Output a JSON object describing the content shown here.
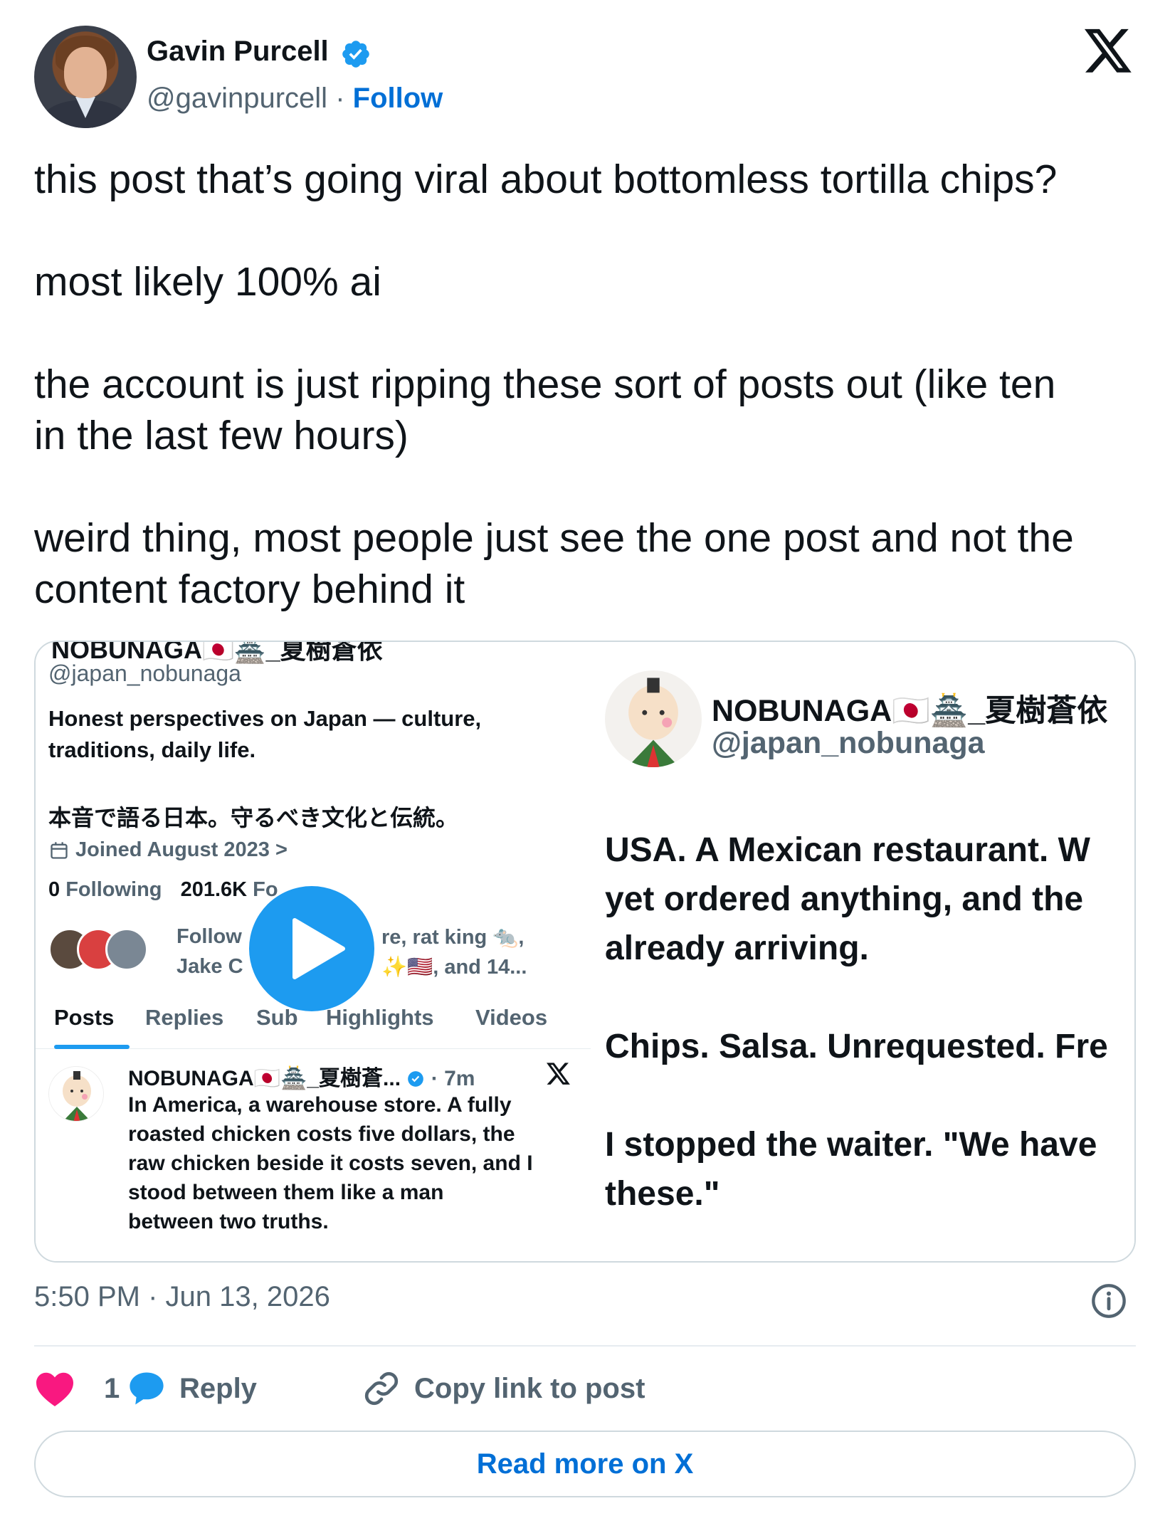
{
  "author": {
    "name": "Gavin Purcell",
    "handle": "@gavinpurcell",
    "separator": "·",
    "follow_label": "Follow"
  },
  "post": {
    "paragraphs": [
      [
        "this post that’s going viral about bottomless tortilla chips?"
      ],
      [
        "most likely 100% ai"
      ],
      [
        "the account is just ripping these sort of posts out (like ten",
        "in the last few hours)"
      ],
      [
        "weird thing, most people just see the one post and not the",
        "content factory behind it"
      ]
    ],
    "timestamp": "5:50 PM · Jun 13, 2026"
  },
  "media": {
    "left": {
      "cut_name": "NOBUNAGA🇯🇵🏯_夏樹蒼依",
      "handle": "@japan_nobunaga",
      "bio_line1": "Honest perspectives on Japan — culture,",
      "bio_line2": "traditions, daily life.",
      "bio_jp": "本音で語る日本。守るべき文化と伝統。",
      "joined": "Joined August 2023 >",
      "following_count": "0",
      "following_label": "Following",
      "followers_count": "201.6K",
      "followers_label": "Fo",
      "followed_by_1": "Follow",
      "followed_by_2": "Jake C",
      "followed_by_3": "re, rat king 🐀,",
      "followed_by_4": "✨🇺🇸, and 14...",
      "tabs": [
        "Posts",
        "Replies",
        "Sub",
        "Highlights",
        "Videos"
      ],
      "embedded_post": {
        "name": "NOBUNAGA🇯🇵🏯_夏樹蒼...",
        "meta": "· 7m",
        "text_lines": [
          "In America, a warehouse store. A fully",
          "roasted chicken costs five dollars, the",
          "raw chicken beside it costs seven, and I",
          "stood between them like a man",
          "between two truths."
        ]
      }
    },
    "right": {
      "name": "NOBUNAGA🇯🇵🏯_夏樹蒼依",
      "handle": "@japan_nobunaga",
      "lines": [
        "USA. A Mexican restaurant. W",
        "yet ordered anything, and the",
        "already arriving.",
        "",
        "Chips. Salsa. Unrequested. Fre",
        "",
        "I stopped the waiter. \"We have",
        "these.\""
      ]
    },
    "play_icon": "play-icon"
  },
  "actions": {
    "like_count": "1",
    "reply_label": "Reply",
    "copy_label": "Copy link to post"
  },
  "read_more_label": "Read more on X",
  "colors": {
    "link_blue": "#006fd6",
    "verified_blue": "#1d9bf0",
    "heart_pink": "#f91880",
    "muted": "#536471"
  }
}
